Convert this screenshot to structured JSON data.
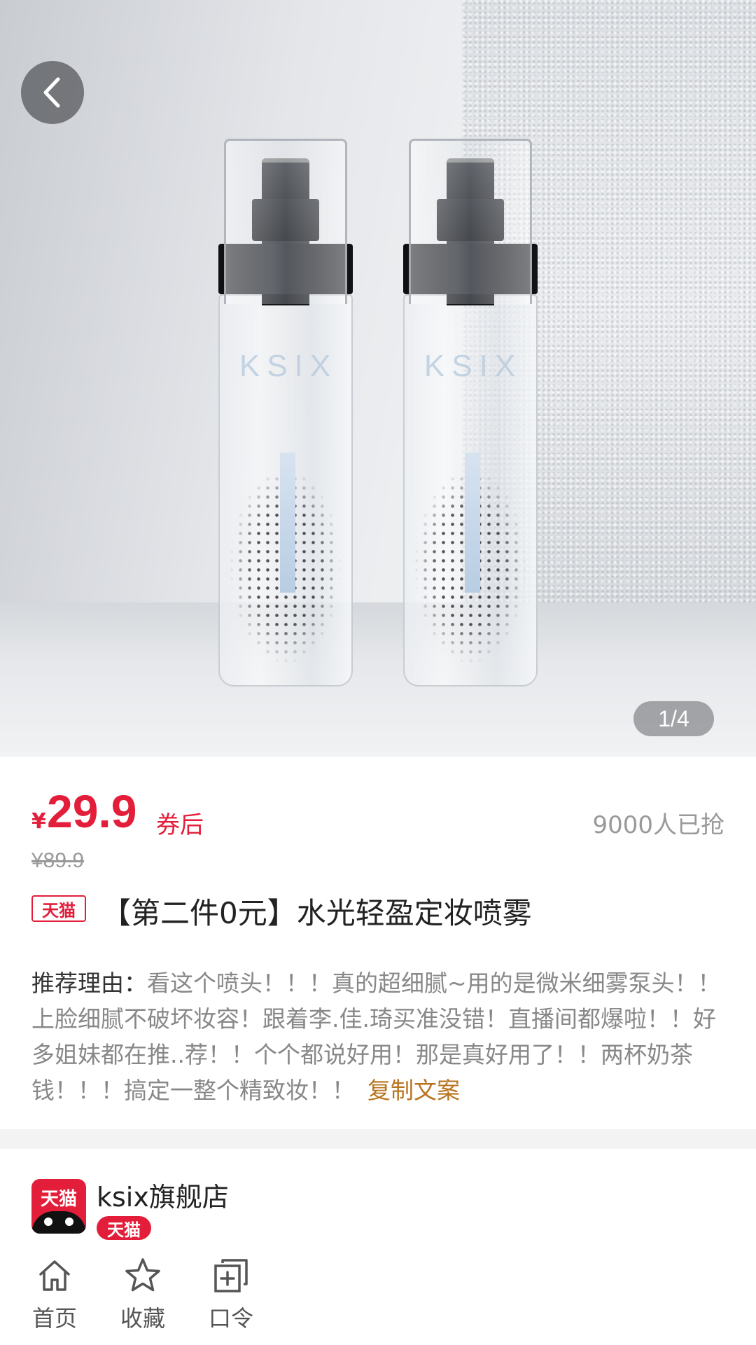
{
  "hero": {
    "page_indicator": "1/4",
    "bottle_brand": "KSIX",
    "back_icon": "chevron-left-icon"
  },
  "price": {
    "currency": "¥",
    "value": "29.9",
    "after_coupon": "券后",
    "sold_count": "9000人已抢",
    "original": "¥89.9"
  },
  "product": {
    "tag": "天猫",
    "title": "【第二件0元】水光轻盈定妆喷雾"
  },
  "reason": {
    "label": "推荐理由：",
    "text": "看这个喷头！！！真的超细腻~用的是微米细雾泵头！！上脸细腻不破坏妆容！跟着李.佳.琦买准没错！直播间都爆啦！！好多姐妹都在推..荐！！个个都说好用！那是真好用了！！两杯奶茶钱！！！搞定一整个精致妆！！",
    "copy_label": "复制文案"
  },
  "shop": {
    "logo_text": "天猫",
    "name": "ksix旗舰店",
    "badge": "天猫"
  },
  "nav": {
    "items": [
      {
        "label": "首页",
        "icon": "home-icon"
      },
      {
        "label": "收藏",
        "icon": "star-icon"
      },
      {
        "label": "口令",
        "icon": "copy-plus-icon"
      }
    ]
  },
  "colors": {
    "accent": "#e31e3a",
    "copy_link": "#b8731e",
    "muted": "#999999"
  }
}
